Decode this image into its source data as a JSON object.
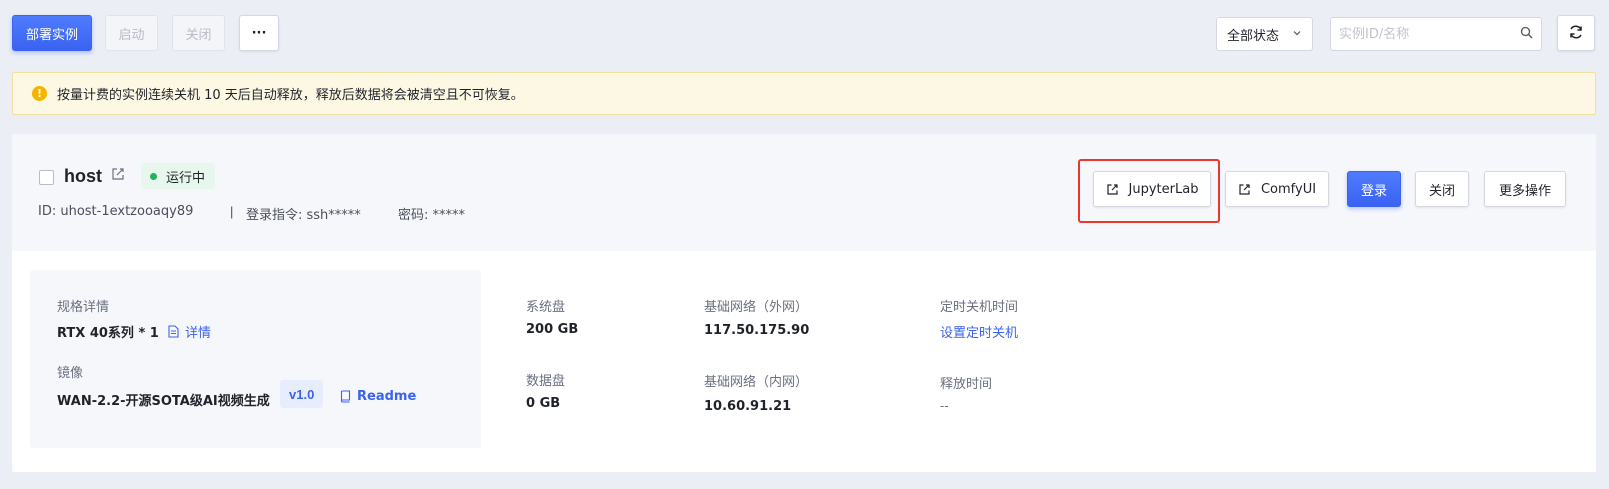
{
  "toolbar": {
    "deploy_label": "部署实例",
    "start_label": "启动",
    "close_label": "关闭",
    "more_label": "···",
    "status_filter": "全部状态",
    "search_placeholder": "实例ID/名称"
  },
  "notice": {
    "text": "按量计费的实例连续关机 10 天后自动释放，释放后数据将会被清空且不可恢复。"
  },
  "instance": {
    "name": "host",
    "status": "运行中",
    "id_text": "ID: uhost-1extzooaqy89",
    "separator": "|",
    "login_cmd": "登录指令: ssh*****",
    "password": "密码: *****",
    "actions": {
      "jupyter": "JupyterLab",
      "comfy": "ComfyUI",
      "login": "登录",
      "close": "关闭",
      "more": "更多操作"
    }
  },
  "details": {
    "spec_label": "规格详情",
    "spec_value": "RTX 40系列 * 1",
    "spec_link": "详情",
    "image_label": "镜像",
    "image_value": "WAN-2.2-开源SOTA级AI视频生成",
    "image_version": "v1.0",
    "image_link": "Readme",
    "sys_disk_label": "系统盘",
    "sys_disk_value": "200 GB",
    "data_disk_label": "数据盘",
    "data_disk_value": "0 GB",
    "ext_net_label": "基础网络（外网）",
    "ext_net_value": "117.50.175.90",
    "int_net_label": "基础网络（内网）",
    "int_net_value": "10.60.91.21",
    "shutdown_label": "定时关机时间",
    "shutdown_link": "设置定时关机",
    "release_label": "释放时间",
    "release_value": "--"
  },
  "colors": {
    "primary": "#3a63f0",
    "highlight": "#e8372e",
    "running": "#1fb35a",
    "warning": "#f5b400"
  }
}
